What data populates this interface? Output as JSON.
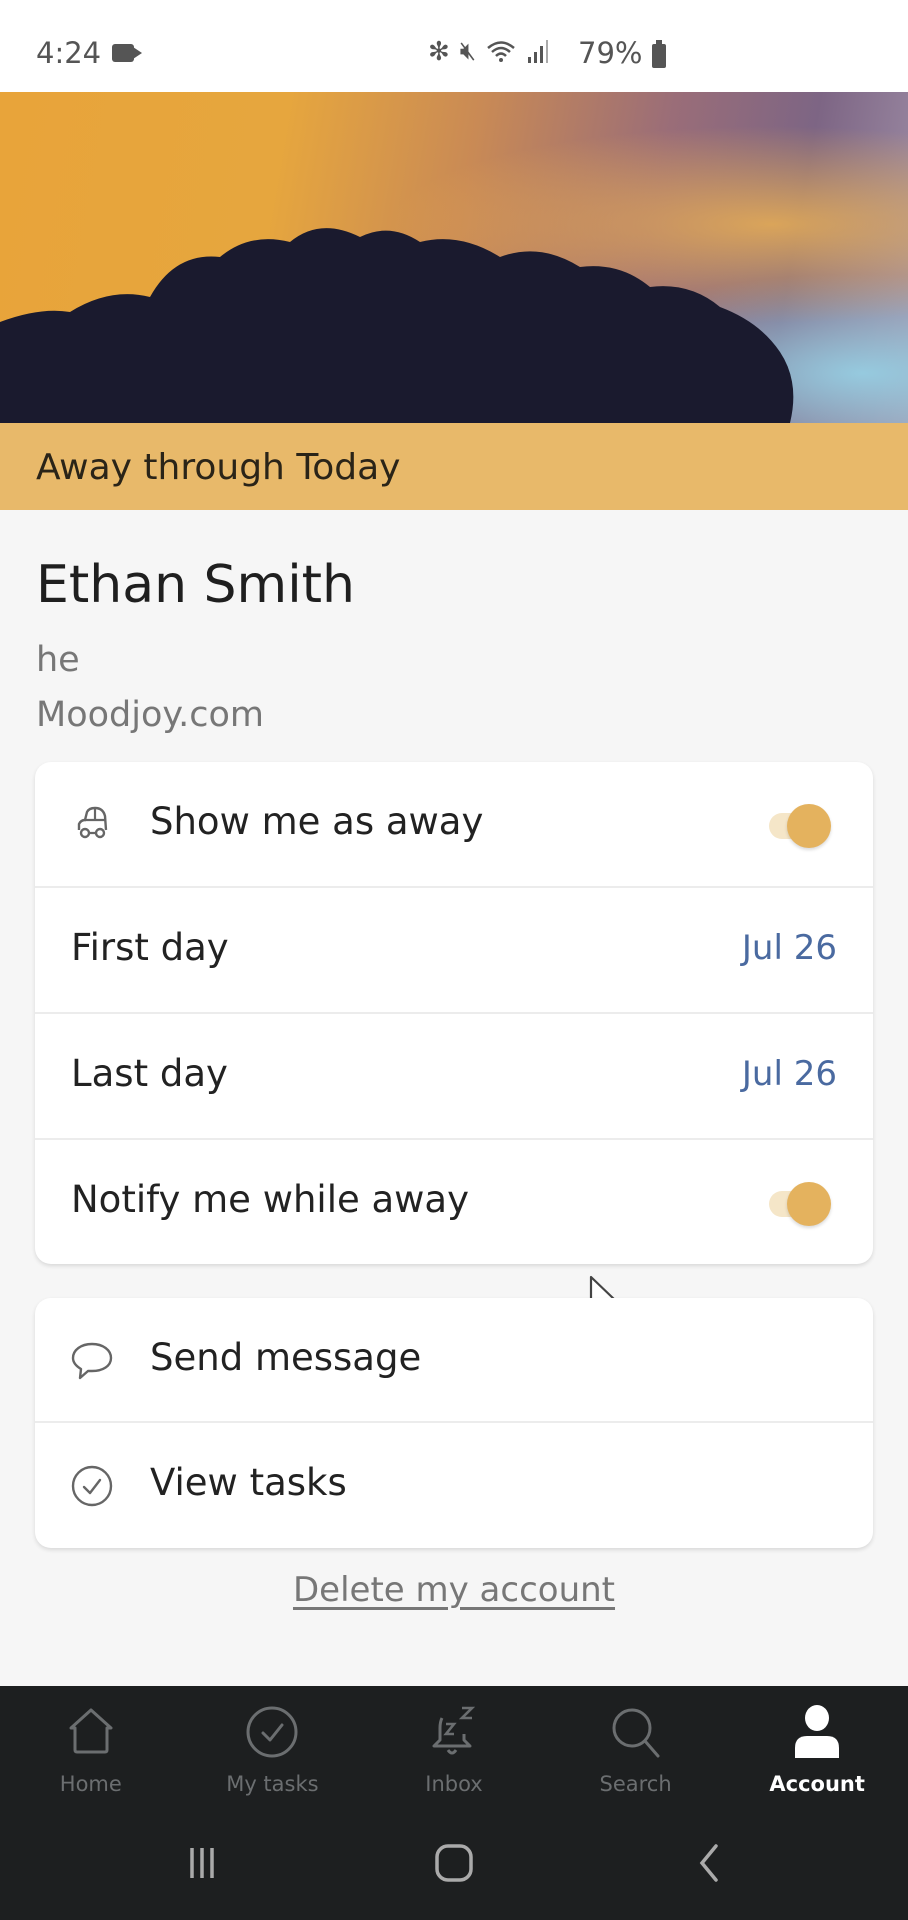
{
  "status_bar": {
    "time": "4:24",
    "battery_percent": "79%",
    "icons": [
      "video-recording-icon",
      "bluetooth-icon",
      "mute-icon",
      "wifi-icon",
      "signal-icon",
      "battery-icon"
    ]
  },
  "banner": {
    "status_text": "Away through Today",
    "color": "#e8b96a"
  },
  "profile": {
    "name": "Ethan Smith",
    "pronouns": "he",
    "organization": "Moodjoy.com"
  },
  "away_settings": {
    "rows": [
      {
        "icon": "car-icon",
        "label": "Show me as away",
        "toggle_on": true
      },
      {
        "label": "First day",
        "value": "Jul 26"
      },
      {
        "label": "Last day",
        "value": "Jul 26"
      },
      {
        "label": "Notify me while away",
        "toggle_on": true
      }
    ]
  },
  "actions": {
    "rows": [
      {
        "icon": "chat-bubble-icon",
        "label": "Send message"
      },
      {
        "icon": "check-circle-icon",
        "label": "View tasks"
      }
    ]
  },
  "delete_account_label": "Delete my account",
  "bottom_nav": {
    "tabs": [
      {
        "icon": "home-icon",
        "label": "Home",
        "active": false
      },
      {
        "icon": "check-circle-icon",
        "label": "My tasks",
        "active": false
      },
      {
        "icon": "snoozed-bell-icon",
        "label": "Inbox",
        "active": false
      },
      {
        "icon": "search-icon",
        "label": "Search",
        "active": false
      },
      {
        "icon": "account-icon",
        "label": "Account",
        "active": true
      }
    ]
  },
  "colors": {
    "accent": "#e4b25e",
    "date_value": "#4a6aa0",
    "nav_background": "#1d1f20"
  }
}
